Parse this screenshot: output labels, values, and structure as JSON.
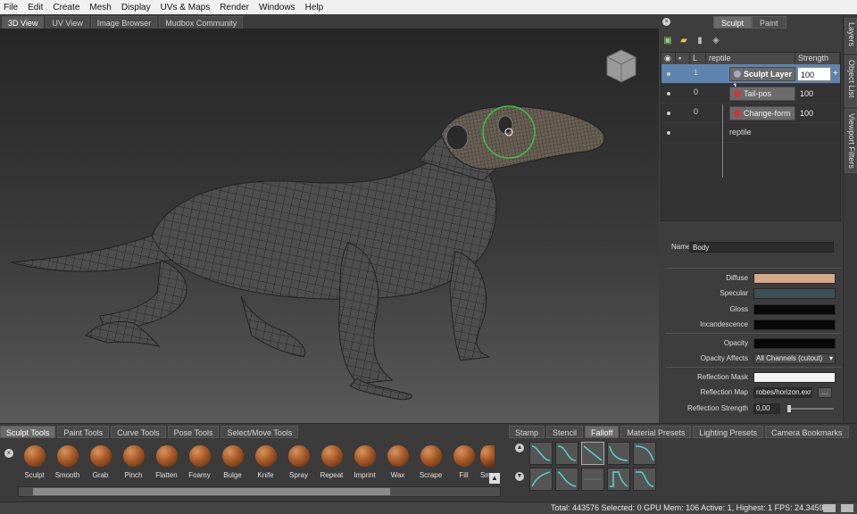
{
  "menu": [
    "File",
    "Edit",
    "Create",
    "Mesh",
    "Display",
    "UVs & Maps",
    "Render",
    "Windows",
    "Help"
  ],
  "viewport_tabs": [
    {
      "label": "3D View",
      "active": true
    },
    {
      "label": "UV View",
      "active": false
    },
    {
      "label": "Image Browser",
      "active": false
    },
    {
      "label": "Mudbox Community",
      "active": false
    }
  ],
  "right_panel": {
    "tabs": [
      {
        "label": "Sculpt",
        "active": true
      },
      {
        "label": "Paint",
        "active": false
      }
    ],
    "layers_header": {
      "lock_col": "L",
      "name_col": "reptile",
      "strength_col": "Strength"
    },
    "layers": [
      {
        "lock": "1",
        "name": "Sculpt Layer 1",
        "strength": "100",
        "selected": true
      },
      {
        "lock": "0",
        "name": "Tail-pos",
        "strength": "100",
        "selected": false
      },
      {
        "lock": "0",
        "name": "Change-form",
        "strength": "100",
        "selected": false
      }
    ],
    "base_layer": "reptile",
    "side_tabs": [
      "Layers",
      "Object List",
      "Viewport Filters"
    ]
  },
  "properties": {
    "name_label": "Name",
    "name_value": "Body",
    "diffuse_label": "Diffuse",
    "diffuse_color": "#d4a88a",
    "specular_label": "Specular",
    "specular_color": "#3c5056",
    "gloss_label": "Gloss",
    "gloss_color": "#080808",
    "incandescence_label": "Incandescence",
    "incandescence_color": "#080808",
    "opacity_label": "Opacity",
    "opacity_color": "#080808",
    "opacity_affects_label": "Opacity Affects",
    "opacity_affects_value": "All Channels (cutout)",
    "reflection_mask_label": "Reflection Mask",
    "reflection_map_label": "Reflection Map",
    "reflection_map_value": "robes/horizon.exr",
    "reflection_map_button": "...",
    "reflection_strength_label": "Reflection Strength",
    "reflection_strength_value": "0,00"
  },
  "tool_tabs": [
    {
      "label": "Sculpt Tools",
      "active": true
    },
    {
      "label": "Paint Tools",
      "active": false
    },
    {
      "label": "Curve Tools",
      "active": false
    },
    {
      "label": "Pose Tools",
      "active": false
    },
    {
      "label": "Select/Move Tools",
      "active": false
    }
  ],
  "tools": [
    "Sculpt",
    "Smooth",
    "Grab",
    "Pinch",
    "Flatten",
    "Foamy",
    "Bulge",
    "Knife",
    "Spray",
    "Repeat",
    "Imprint",
    "Wax",
    "Scrape",
    "Fill",
    "Sme"
  ],
  "stamp_tabs": [
    {
      "label": "Stamp",
      "active": false
    },
    {
      "label": "Stencil",
      "active": false
    },
    {
      "label": "Falloff",
      "active": true
    },
    {
      "label": "Material Presets",
      "active": false
    },
    {
      "label": "Lighting Presets",
      "active": false
    },
    {
      "label": "Camera Bookmarks",
      "active": false
    }
  ],
  "status": "Total: 443576  Selected: 0 GPU Mem: 106  Active: 1, Highest: 1  FPS: 24.3459"
}
